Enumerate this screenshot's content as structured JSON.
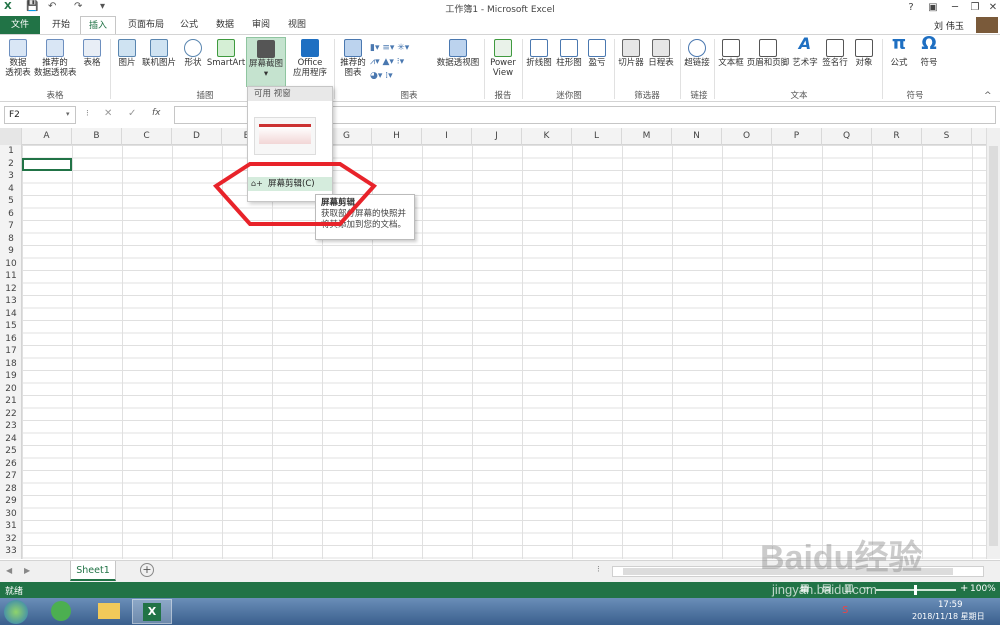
{
  "window": {
    "title": "工作簿1 - Microsoft Excel",
    "user": "刘 伟玉",
    "help": "?",
    "qat": [
      "💾",
      "↶",
      "↷",
      "▾"
    ]
  },
  "tabs": [
    "文件",
    "开始",
    "插入",
    "页面布局",
    "公式",
    "数据",
    "审阅",
    "视图"
  ],
  "ribbon": {
    "buttons": [
      {
        "label": "数据\n透视表"
      },
      {
        "label": "推荐的\n数据透视表"
      },
      {
        "label": "表格"
      },
      {
        "label": "图片"
      },
      {
        "label": "联机图片"
      },
      {
        "label": "形状"
      },
      {
        "label": "SmartArt"
      },
      {
        "label": "屏幕截图"
      },
      {
        "label": "Office\n应用程序"
      },
      {
        "label": "推荐的\n图表"
      },
      {
        "label": "数据透视图"
      },
      {
        "label": "Power\nView"
      },
      {
        "label": "折线图"
      },
      {
        "label": "柱形图"
      },
      {
        "label": "盈亏"
      },
      {
        "label": "切片器"
      },
      {
        "label": "日程表"
      },
      {
        "label": "超链接"
      },
      {
        "label": "文本框"
      },
      {
        "label": "页眉和页脚"
      },
      {
        "label": "艺术字"
      },
      {
        "label": "签名行"
      },
      {
        "label": "对象"
      },
      {
        "label": "公式"
      },
      {
        "label": "符号"
      }
    ],
    "groups": [
      "表格",
      "插图",
      "图表",
      "报告",
      "迷你图",
      "筛选器",
      "链接",
      "文本",
      "符号"
    ]
  },
  "formula_bar": {
    "name_box": "F2",
    "cancel": "✕",
    "enter": "✓",
    "fx": "fx"
  },
  "columns": [
    "A",
    "B",
    "C",
    "D",
    "E",
    "F",
    "G",
    "H",
    "I",
    "J",
    "K",
    "L",
    "M",
    "N",
    "O",
    "P",
    "Q",
    "R",
    "S"
  ],
  "rows": [
    1,
    2,
    3,
    4,
    5,
    6,
    7,
    8,
    9,
    10,
    11,
    12,
    13,
    14,
    15,
    16,
    17,
    18,
    19,
    20,
    21,
    22,
    23,
    24,
    25,
    26,
    27,
    28,
    29,
    30,
    31,
    32,
    33
  ],
  "dropdown": {
    "header": "可用 视窗",
    "menu_item": "屏幕剪辑(C)"
  },
  "tooltip": {
    "title": "屏幕剪辑",
    "body": "获取部分屏幕的快照并将其添加到您的文档。"
  },
  "sheet_tabs": {
    "active": "Sheet1",
    "add": "+"
  },
  "status": {
    "ready": "就绪",
    "zoom": "100%"
  },
  "taskbar": {
    "time": "17:59",
    "date": "2018/11/18 星期日"
  },
  "watermark": {
    "text": "Baidu经验",
    "url": "jingyan.baidu.com"
  },
  "colors": {
    "excel_green": "#217346",
    "annotation_red": "#e8232a"
  }
}
